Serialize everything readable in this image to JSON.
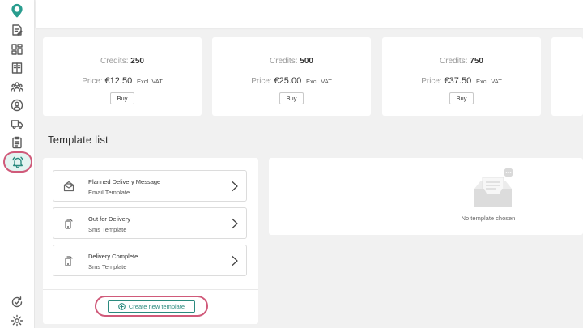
{
  "sidebar": {
    "items": [
      {
        "name": "logo-pin",
        "icon": "location-pin-logo"
      },
      {
        "name": "edit",
        "icon": "edit-document-icon"
      },
      {
        "name": "dashboard",
        "icon": "dashboard-icon"
      },
      {
        "name": "reports",
        "icon": "book-icon"
      },
      {
        "name": "team",
        "icon": "team-icon"
      },
      {
        "name": "account",
        "icon": "user-circle-icon"
      },
      {
        "name": "delivery",
        "icon": "truck-icon"
      },
      {
        "name": "tasks",
        "icon": "clipboard-icon"
      },
      {
        "name": "notifications",
        "icon": "bell-icon",
        "active": true
      },
      {
        "name": "sync",
        "icon": "sync-check-icon"
      },
      {
        "name": "settings",
        "icon": "gear-icon"
      }
    ]
  },
  "credit_packages": [
    {
      "credits_label": "Credits:",
      "credits": "250",
      "price_label": "Price:",
      "price": "€12.50",
      "vat": "Excl. VAT",
      "buy_label": "Buy"
    },
    {
      "credits_label": "Credits:",
      "credits": "500",
      "price_label": "Price:",
      "price": "€25.00",
      "vat": "Excl. VAT",
      "buy_label": "Buy"
    },
    {
      "credits_label": "Credits:",
      "credits": "750",
      "price_label": "Price:",
      "price": "€37.50",
      "vat": "Excl. VAT",
      "buy_label": "Buy"
    }
  ],
  "template_section": {
    "title": "Template list",
    "templates": [
      {
        "name": "Planned Delivery Message",
        "type": "Email Template",
        "icon": "email-icon"
      },
      {
        "name": "Out for Delivery",
        "type": "Sms Template",
        "icon": "phone-icon"
      },
      {
        "name": "Delivery Complete",
        "type": "Sms Template",
        "icon": "phone-icon"
      }
    ],
    "create_label": "Create new template"
  },
  "preview": {
    "empty_text": "No template chosen"
  },
  "colors": {
    "accent": "#2a8a7e",
    "highlight": "#d05a7a",
    "background": "#f1f1f1"
  }
}
